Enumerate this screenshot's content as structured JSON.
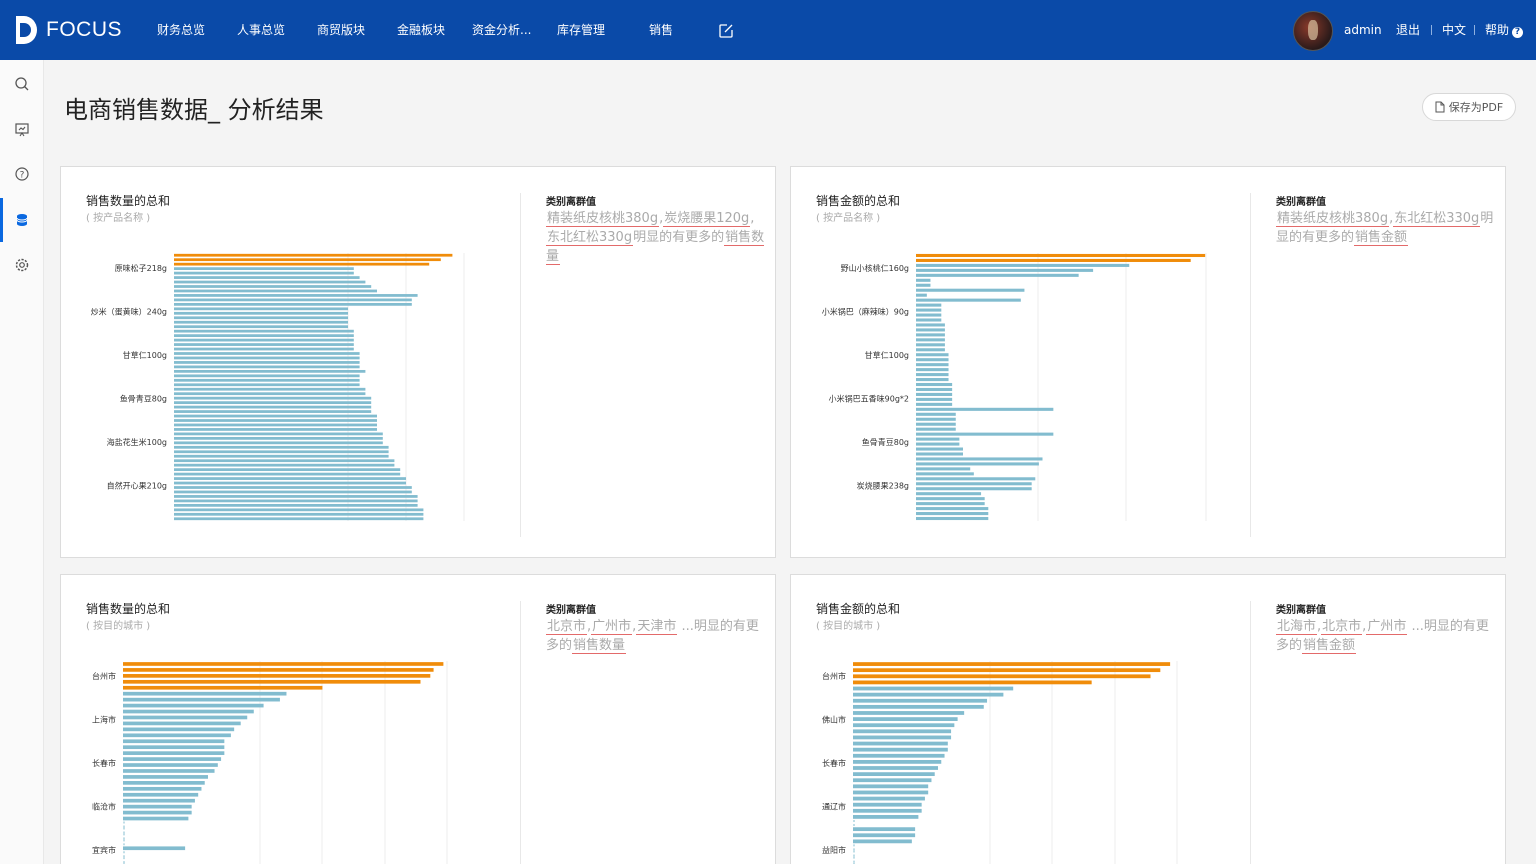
{
  "app": {
    "logo_text": "FOCUS"
  },
  "nav": {
    "items": [
      "财务总览",
      "人事总览",
      "商贸版块",
      "金融板块",
      "资金分析...",
      "库存管理",
      "销售"
    ]
  },
  "header": {
    "user": "admin",
    "logout": "退出",
    "lang": "中文",
    "help": "帮助"
  },
  "sidebar": {
    "icons": [
      "search-icon",
      "presentation-icon",
      "help-circle-icon",
      "database-icon",
      "settings-icon"
    ],
    "active_index": 3
  },
  "page": {
    "title": "电商销售数据_ 分析结果",
    "pdf_button": "保存为PDF"
  },
  "colors": {
    "accent": "#f08c0a",
    "bar": "#82bccf",
    "nav_bg": "#0a4aa8",
    "underline": "#e36a6a"
  },
  "cards": [
    {
      "chart_title": "销售数量的总和",
      "chart_sub": "( 按产品名称 )",
      "insight_title": "类别离群值",
      "insight_parts": [
        {
          "t": "精装纸皮核桃380g",
          "u": true
        },
        {
          "t": ",",
          "u": false
        },
        {
          "t": "炭烧腰果120g",
          "u": true
        },
        {
          "t": ",",
          "u": false
        },
        {
          "t": "东北红松330g",
          "u": true
        },
        {
          "t": "明显的有更多的",
          "u": false
        },
        {
          "t": "销售数量",
          "u": true
        }
      ]
    },
    {
      "chart_title": "销售金额的总和",
      "chart_sub": "( 按产品名称 )",
      "insight_title": "类别离群值",
      "insight_parts": [
        {
          "t": "精装纸皮核桃380g",
          "u": true
        },
        {
          "t": ",",
          "u": false
        },
        {
          "t": "东北红松330g",
          "u": true
        },
        {
          "t": "明显的有更多的",
          "u": false
        },
        {
          "t": "销售金额",
          "u": true
        }
      ]
    },
    {
      "chart_title": "销售数量的总和",
      "chart_sub": "( 按目的城市 )",
      "insight_title": "类别离群值",
      "insight_parts": [
        {
          "t": "北京市",
          "u": true
        },
        {
          "t": ",",
          "u": false
        },
        {
          "t": "广州市",
          "u": true
        },
        {
          "t": ",",
          "u": false
        },
        {
          "t": "天津市",
          "u": true
        },
        {
          "t": " ...明显的有更多的",
          "u": false
        },
        {
          "t": "销售数量",
          "u": true
        }
      ]
    },
    {
      "chart_title": "销售金额的总和",
      "chart_sub": "( 按目的城市 )",
      "insight_title": "类别离群值",
      "insight_parts": [
        {
          "t": "北海市",
          "u": true
        },
        {
          "t": ",",
          "u": false
        },
        {
          "t": "北京市",
          "u": true
        },
        {
          "t": ",",
          "u": false
        },
        {
          "t": "广州市",
          "u": true
        },
        {
          "t": " ...明显的有更多的",
          "u": false
        },
        {
          "t": "销售金额",
          "u": true
        }
      ]
    }
  ],
  "chart_data": [
    {
      "type": "bar",
      "orientation": "horizontal",
      "tick_labels": [
        "原味松子218g",
        "炒米（蛋黄味）240g",
        "甘草仁100g",
        "鱼骨青豆80g",
        "海盐花生米100g",
        "自然开心果210g"
      ],
      "values": [
        4.8,
        4.6,
        4.4,
        3.1,
        3.1,
        3.2,
        3.3,
        3.4,
        3.5,
        4.2,
        4.1,
        4.1,
        3.0,
        3.0,
        3.0,
        3.0,
        3.0,
        3.1,
        3.1,
        3.1,
        3.1,
        3.1,
        3.2,
        3.2,
        3.2,
        3.2,
        3.3,
        3.2,
        3.2,
        3.2,
        3.3,
        3.3,
        3.4,
        3.4,
        3.4,
        3.4,
        3.5,
        3.5,
        3.5,
        3.5,
        3.6,
        3.6,
        3.6,
        3.7,
        3.7,
        3.7,
        3.8,
        3.8,
        3.9,
        3.9,
        4.0,
        4.0,
        4.1,
        4.1,
        4.2,
        4.2,
        4.2,
        4.3,
        4.3,
        4.3
      ],
      "highlight_count": 3
    },
    {
      "type": "bar",
      "orientation": "horizontal",
      "tick_labels": [
        "野山小核桃仁160g",
        "小米锅巴（麻辣味）90g",
        "甘草仁100g",
        "小米锅巴五香味90g*2",
        "鱼骨青豆80g",
        "炭烧腰果238g"
      ],
      "values": [
        8.0,
        7.6,
        5.9,
        4.9,
        4.5,
        0.4,
        0.4,
        3.0,
        0.3,
        2.9,
        0.7,
        0.7,
        0.7,
        0.7,
        0.8,
        0.8,
        0.8,
        0.8,
        0.8,
        0.8,
        0.9,
        0.9,
        0.9,
        0.9,
        0.9,
        0.9,
        1.0,
        1.0,
        1.0,
        1.0,
        1.0,
        3.8,
        1.1,
        1.1,
        1.1,
        1.1,
        3.8,
        1.2,
        1.2,
        1.3,
        1.3,
        3.5,
        3.4,
        1.5,
        1.6,
        3.3,
        3.2,
        3.2,
        1.8,
        1.9,
        1.9,
        2.0,
        2.0,
        2.0
      ],
      "highlight_count": 2
    },
    {
      "type": "bar",
      "orientation": "horizontal",
      "tick_labels": [
        "台州市",
        "上海市",
        "长春市",
        "临沧市",
        "宜宾市"
      ],
      "values": [
        9.8,
        9.5,
        9.4,
        9.1,
        6.1,
        5.0,
        4.8,
        4.3,
        4.0,
        3.8,
        3.6,
        3.4,
        3.3,
        3.1,
        3.1,
        3.1,
        3.0,
        2.9,
        2.8,
        2.6,
        2.5,
        2.4,
        2.3,
        2.2,
        2.1,
        2.1,
        2.0,
        0.0,
        0.0,
        0.0,
        0.0,
        1.9,
        0.0,
        0.0,
        0.0,
        0.0
      ],
      "highlight_count": 5
    },
    {
      "type": "bar",
      "orientation": "horizontal",
      "tick_labels": [
        "台州市",
        "佛山市",
        "长春市",
        "通辽市",
        "益阳市"
      ],
      "values": [
        9.7,
        9.4,
        9.1,
        7.3,
        4.9,
        4.6,
        4.1,
        4.0,
        3.4,
        3.2,
        3.1,
        3.0,
        3.0,
        2.9,
        2.9,
        2.8,
        2.7,
        2.6,
        2.5,
        2.4,
        2.3,
        2.3,
        2.2,
        2.1,
        2.1,
        2.0,
        0.0,
        1.9,
        1.9,
        1.8,
        0.0,
        0.0,
        0.0,
        0.0,
        0.0
      ],
      "highlight_count": 4
    }
  ]
}
